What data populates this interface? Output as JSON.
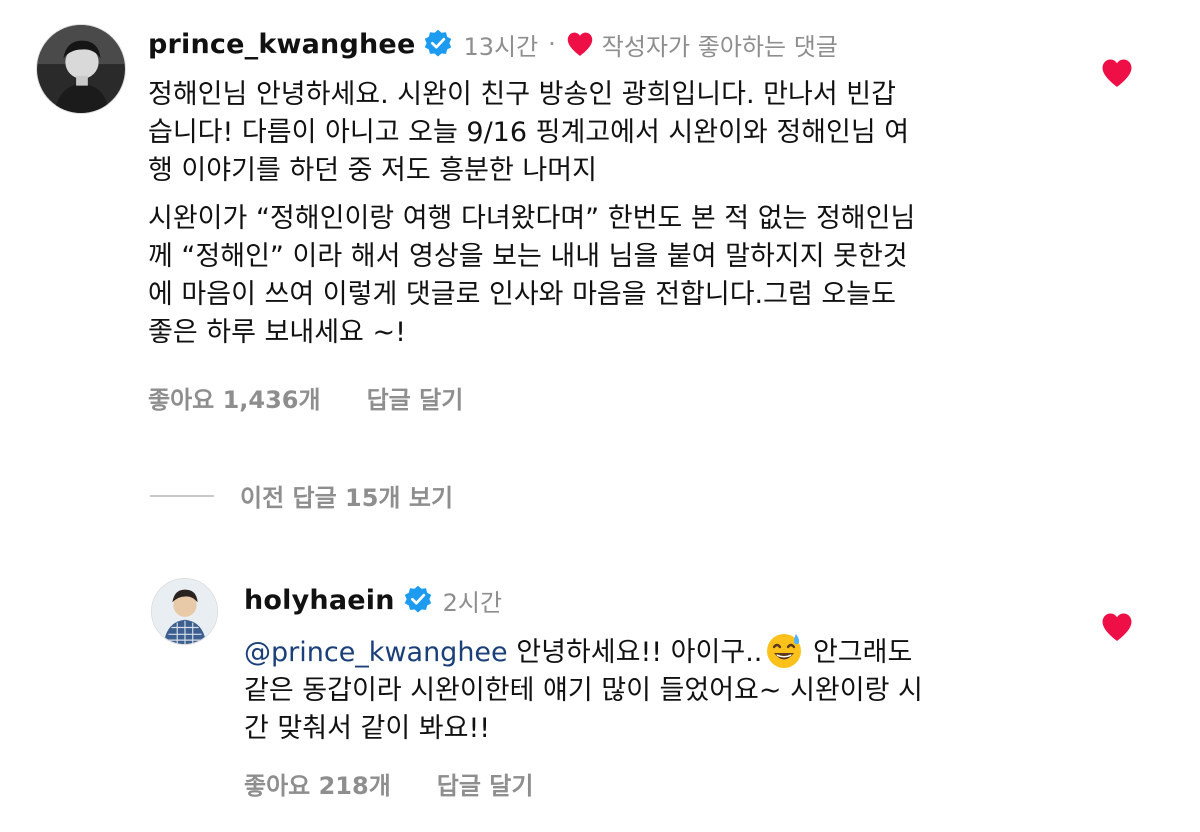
{
  "colors": {
    "heart": "#ed0f45",
    "verified": "#1d9bf0",
    "secondary_text": "#8e8e8e",
    "mention": "#1a3f79"
  },
  "icons": {
    "verified": "verified-badge-icon",
    "heart_liked": "heart-filled-icon",
    "emoji": "sweat-smile-emoji"
  },
  "comments": [
    {
      "username": "prince_kwanghee",
      "time": "13시간",
      "separator": "·",
      "creator_liked_label": "작성자가 좋아하는 댓글",
      "paragraphs": [
        [
          "정해인님 안녕하세요. 시완이 친구 방송인 광희입니다. 만나서 빈갑",
          "습니다! 다름이 아니고 오늘 9/16 핑계고에서 시완이와 정해인님 여",
          "행 이야기를 하던 중 저도 흥분한 나머지"
        ],
        [
          "시완이가 “정해인이랑 여행 다녀왔다며” 한번도 본 적 없는 정해인님",
          "께 “정해인” 이라 해서 영상을 보는 내내 님을 붙여 말하지지 못한것",
          "에 마음이 쓰여 이렇게 댓글로 인사와 마음을 전합니다.그럼 오늘도",
          "좋은 하루 보내세요 ~!"
        ]
      ],
      "likes": "좋아요 1,436개",
      "reply_label": "답글 달기"
    },
    {
      "username": "holyhaein",
      "time": "2시간",
      "mention": "@prince_kwanghee",
      "lines": [
        " 안녕하세요!! 아이구..",
        " 안그래도",
        "같은 동갑이라 시완이한테 얘기 많이 들었어요~ 시완이랑 시",
        "간 맞춰서 같이 봐요!!"
      ],
      "likes": "좋아요 218개",
      "reply_label": "답글 달기"
    }
  ],
  "view_previous_replies": "이전 답글 15개 보기"
}
